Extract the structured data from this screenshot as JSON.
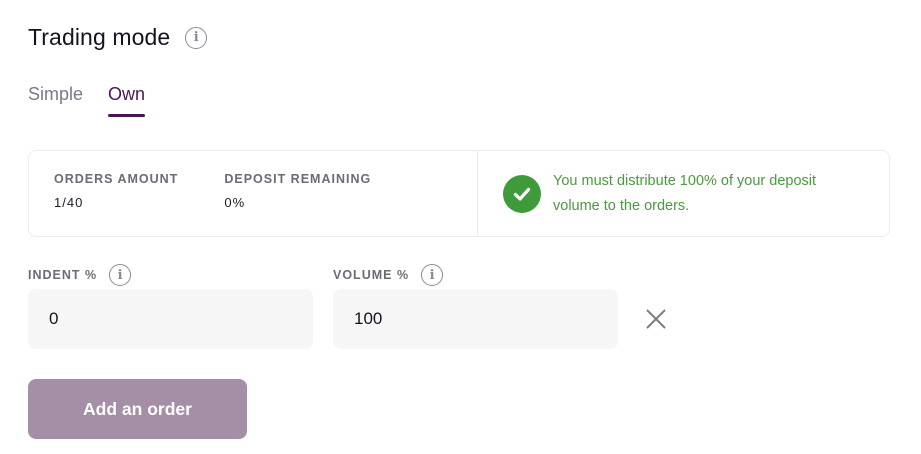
{
  "header": {
    "title": "Trading mode",
    "info_icon": "info-icon"
  },
  "tabs": [
    {
      "label": "Simple",
      "active": false
    },
    {
      "label": "Own",
      "active": true
    }
  ],
  "stats": {
    "orders_amount_label": "ORDERS AMOUNT",
    "orders_amount_value": "1/40",
    "deposit_remaining_label": "DEPOSIT REMAINING",
    "deposit_remaining_value": "0%",
    "status_icon": "check-circle-icon",
    "status_message": "You must distribute 100% of your deposit volume to the orders."
  },
  "order": {
    "indent_label": "INDENT %",
    "indent_value": "0",
    "volume_label": "VOLUME %",
    "volume_value": "100",
    "remove_icon": "close-icon"
  },
  "actions": {
    "add_label": "Add an order"
  },
  "colors": {
    "accent": "#4a1557",
    "success": "#3f9b3a",
    "success_text": "#4a9a3e",
    "button_bg": "#a58fa7",
    "input_bg": "#f6f6f7"
  }
}
